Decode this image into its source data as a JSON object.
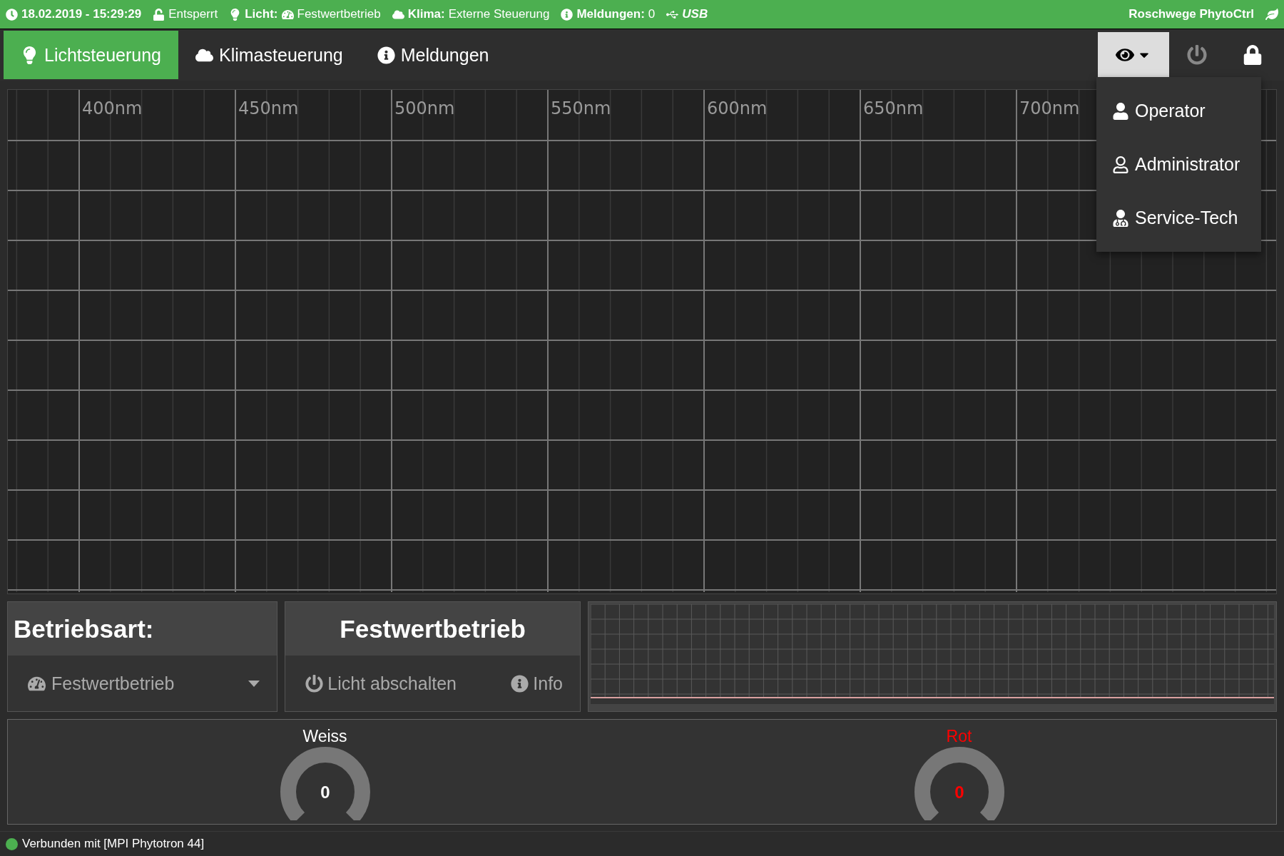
{
  "status_bar_top": {
    "items": [
      {
        "kind": "clock",
        "label": "18.02.2019 - 15:29:29"
      },
      {
        "kind": "lock",
        "value": "Entsperrt"
      },
      {
        "kind": "light",
        "label": "Licht:",
        "value": "Festwertbetrieb"
      },
      {
        "kind": "climate",
        "label": "Klima:",
        "value": "Externe Steuerung"
      },
      {
        "kind": "messages",
        "label": "Meldungen:",
        "value": "0"
      },
      {
        "kind": "usb",
        "label": "USB"
      }
    ],
    "brand": "Roschwege PhytoCtrl"
  },
  "tabs": [
    {
      "label": "Lichtsteuerung",
      "selected": true
    },
    {
      "label": "Klimasteuerung",
      "selected": false
    },
    {
      "label": "Meldungen",
      "selected": false
    }
  ],
  "user_menu": {
    "expanded": true,
    "items": [
      {
        "label": "Operator"
      },
      {
        "label": "Administrator"
      },
      {
        "label": "Service-Tech"
      }
    ]
  },
  "spectrum": {
    "tick_labels": [
      "400nm",
      "450nm",
      "500nm",
      "550nm",
      "600nm",
      "650nm",
      "700nm"
    ]
  },
  "mode_panel": {
    "title": "Betriebsart:",
    "value": "Festwertbetrieb"
  },
  "action_panel": {
    "title": "Festwertbetrieb",
    "buttons": [
      "Licht abschalten",
      "Info"
    ]
  },
  "gauges": [
    {
      "name": "Weiss",
      "value": "0",
      "color": "#ffffff"
    },
    {
      "name": "Rot",
      "value": "0",
      "color": "#ff0000"
    }
  ],
  "footer": {
    "connected": true,
    "text": "Verbunden mit [MPI Phytotron 44]"
  }
}
